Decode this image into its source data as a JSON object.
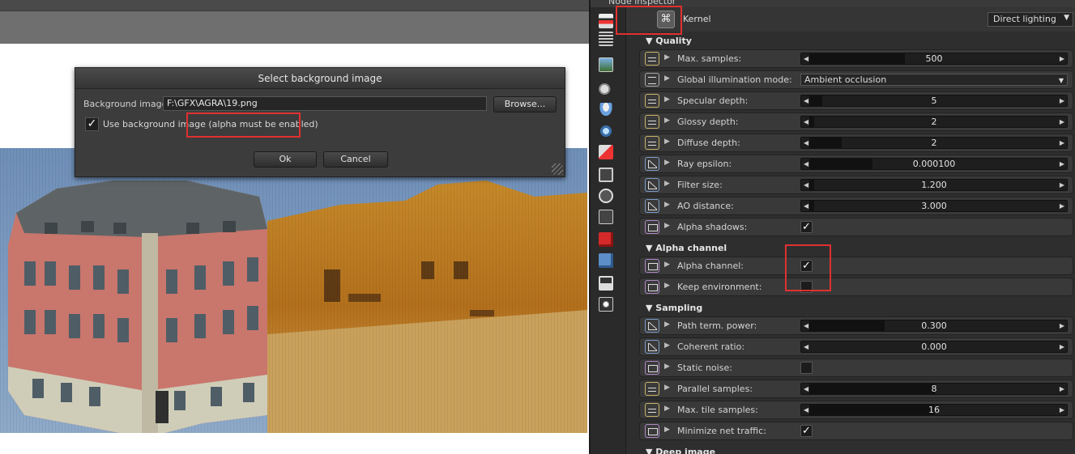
{
  "dialog": {
    "title": "Select background image",
    "bg_label": "Background image:",
    "bg_path": "F:\\GFX\\AGRA\\19.png",
    "browse_label": "Browse...",
    "use_bg_label": "Use background image (alpha must be enabled)",
    "use_bg_checked": true,
    "ok_label": "Ok",
    "cancel_label": "Cancel"
  },
  "inspector": {
    "title": "Node inspector",
    "kernel_label": "Kernel",
    "kernel_select": "Direct lighting",
    "sections": {
      "quality": "Quality",
      "alpha": "Alpha channel",
      "sampling": "Sampling",
      "deep": "Deep image"
    },
    "params": [
      {
        "label": "Max. samples:",
        "value": "500",
        "kind": "int",
        "fill": 0.38
      },
      {
        "label": "Global illumination mode:",
        "value": "Ambient occlusion",
        "kind": "enum"
      },
      {
        "label": "Specular depth:",
        "value": "5",
        "kind": "int",
        "fill": 0.05
      },
      {
        "label": "Glossy depth:",
        "value": "2",
        "kind": "int",
        "fill": 0.02
      },
      {
        "label": "Diffuse depth:",
        "value": "2",
        "kind": "int",
        "fill": 0.13
      },
      {
        "label": "Ray epsilon:",
        "value": "0.000100",
        "kind": "float",
        "fill": 0.25
      },
      {
        "label": "Filter size:",
        "value": "1.200",
        "kind": "float",
        "fill": 0.02
      },
      {
        "label": "AO distance:",
        "value": "3.000",
        "kind": "float",
        "fill": 0.02
      },
      {
        "label": "Alpha shadows:",
        "value": "checked",
        "kind": "bool"
      },
      {
        "label": "Alpha channel:",
        "value": "checked",
        "kind": "bool"
      },
      {
        "label": "Keep environment:",
        "value": "unchecked",
        "kind": "bool"
      },
      {
        "label": "Path term. power:",
        "value": "0.300",
        "kind": "float",
        "fill": 0.3
      },
      {
        "label": "Coherent ratio:",
        "value": "0.000",
        "kind": "float",
        "fill": 0.0
      },
      {
        "label": "Static noise:",
        "value": "unchecked",
        "kind": "bool"
      },
      {
        "label": "Parallel samples:",
        "value": "8",
        "kind": "int",
        "fill": 0.5
      },
      {
        "label": "Max. tile samples:",
        "value": "16",
        "kind": "int",
        "fill": 0.5
      },
      {
        "label": "Minimize net traffic:",
        "value": "checked",
        "kind": "bool"
      }
    ]
  },
  "colors": {
    "highlight": "#e03030",
    "panel_bg": "#2e2e2e",
    "row_bg": "#393939"
  }
}
